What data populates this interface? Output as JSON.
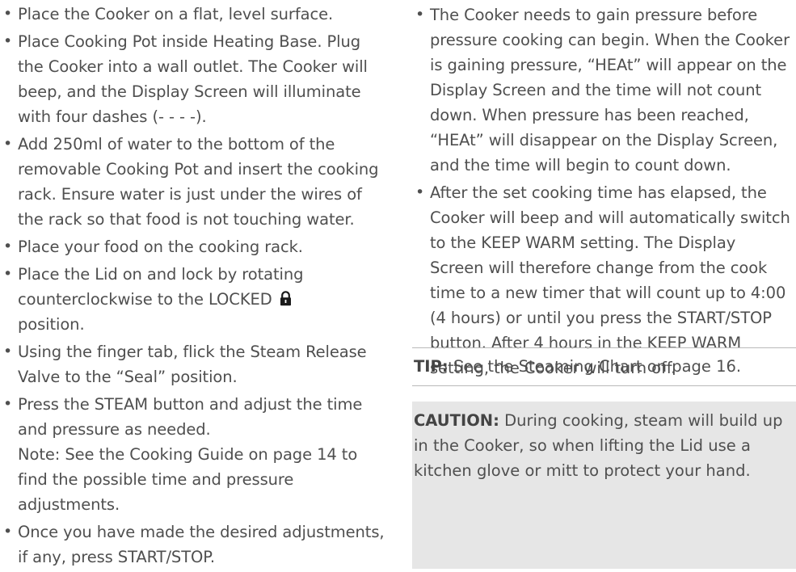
{
  "left_steps": [
    "Place the Cooker on a flat, level surface.",
    "Place Cooking Pot inside Heating Base. Plug the Cooker into a wall outlet. The Cooker will beep, and the Display Screen will illuminate with four dashes (- - - -).",
    "Add 250ml of water to the bottom of the removable Cooking Pot and insert the cooking rack. Ensure water is just under the wires of the rack so that food is not touching water.",
    "Place your food on the cooking rack.",
    {
      "before": "Place the Lid on and lock by rotating counterclockwise to the LOCKED",
      "icon": "lock-icon",
      "after": "position."
    },
    "Using the finger tab, flick the Steam Release Valve to the “Seal” position.",
    {
      "text": "Press the STEAM button and adjust the time and pressure as needed.",
      "note": "Note: See the Cooking Guide on page 14 to find the possible time and pressure adjustments."
    },
    "Once you have made the desired adjustments, if any, press START/STOP."
  ],
  "right_steps": [
    "The Cooker needs to gain pressure before pressure cooking can begin. When the Cooker is gaining pressure, “HEAt” will appear on the Display Screen and the time will not count down. When pressure has been reached, “HEAt” will disappear on the Display Screen, and the time will begin to count down.",
    "After the set cooking time has elapsed, the Cooker will beep and will automatically switch to the KEEP WARM setting. The Display Screen will therefore change from the cook time to a new timer that will count up to 4:00 (4 hours) or until you press the START/STOP button. After 4 hours in the KEEP WARM setting, the Cooker will turn off."
  ],
  "tip": {
    "label": "TIP:",
    "text": "See the Steaming Chart on page 16."
  },
  "caution": {
    "label": "CAUTION:",
    "text": "During cooking, steam will build up in the Cooker, so when lifting the Lid use a kitchen glove or mitt to protect your hand."
  },
  "bullet_glyph": "•",
  "colors": {
    "text": "#4f4f4f",
    "caution_bg": "#e6e6e6",
    "rule": "#b9b9b9"
  }
}
